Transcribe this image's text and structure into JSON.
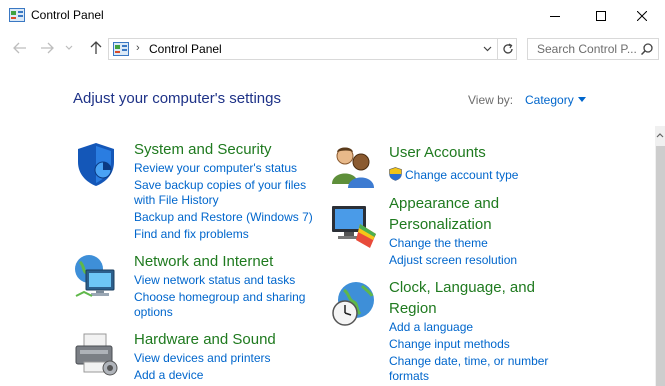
{
  "window": {
    "title": "Control Panel",
    "minimize_icon": "minimize-icon",
    "maximize_icon": "maximize-icon",
    "close_icon": "close-icon"
  },
  "nav": {
    "address_separator": "›",
    "address_text": "Control Panel",
    "search_placeholder": "Search Control P..."
  },
  "main": {
    "heading": "Adjust your computer's settings",
    "view_by_label": "View by:",
    "view_by_value": "Category"
  },
  "categories": {
    "system": {
      "title": "System and Security",
      "links": [
        "Review your computer's status",
        "Save backup copies of your files",
        "with File History",
        "Backup and Restore (Windows 7)",
        "Find and fix problems"
      ]
    },
    "network": {
      "title": "Network and Internet",
      "links": [
        "View network status and tasks",
        "Choose homegroup and sharing",
        "options"
      ]
    },
    "hardware": {
      "title": "Hardware and Sound",
      "links": [
        "View devices and printers",
        "Add a device"
      ]
    },
    "users": {
      "title": "User Accounts",
      "links": [
        "Change account type"
      ]
    },
    "appearance": {
      "title_lines": [
        "Appearance and",
        "Personalization"
      ],
      "links": [
        "Change the theme",
        "Adjust screen resolution"
      ]
    },
    "clock": {
      "title_lines": [
        "Clock, Language, and",
        "Region"
      ],
      "links": [
        "Add a language",
        "Change input methods",
        "Change date, time, or number",
        "formats"
      ]
    }
  },
  "colors": {
    "heading": "#1e3287",
    "category_title": "#1f7a1f",
    "link": "#0066cc"
  }
}
